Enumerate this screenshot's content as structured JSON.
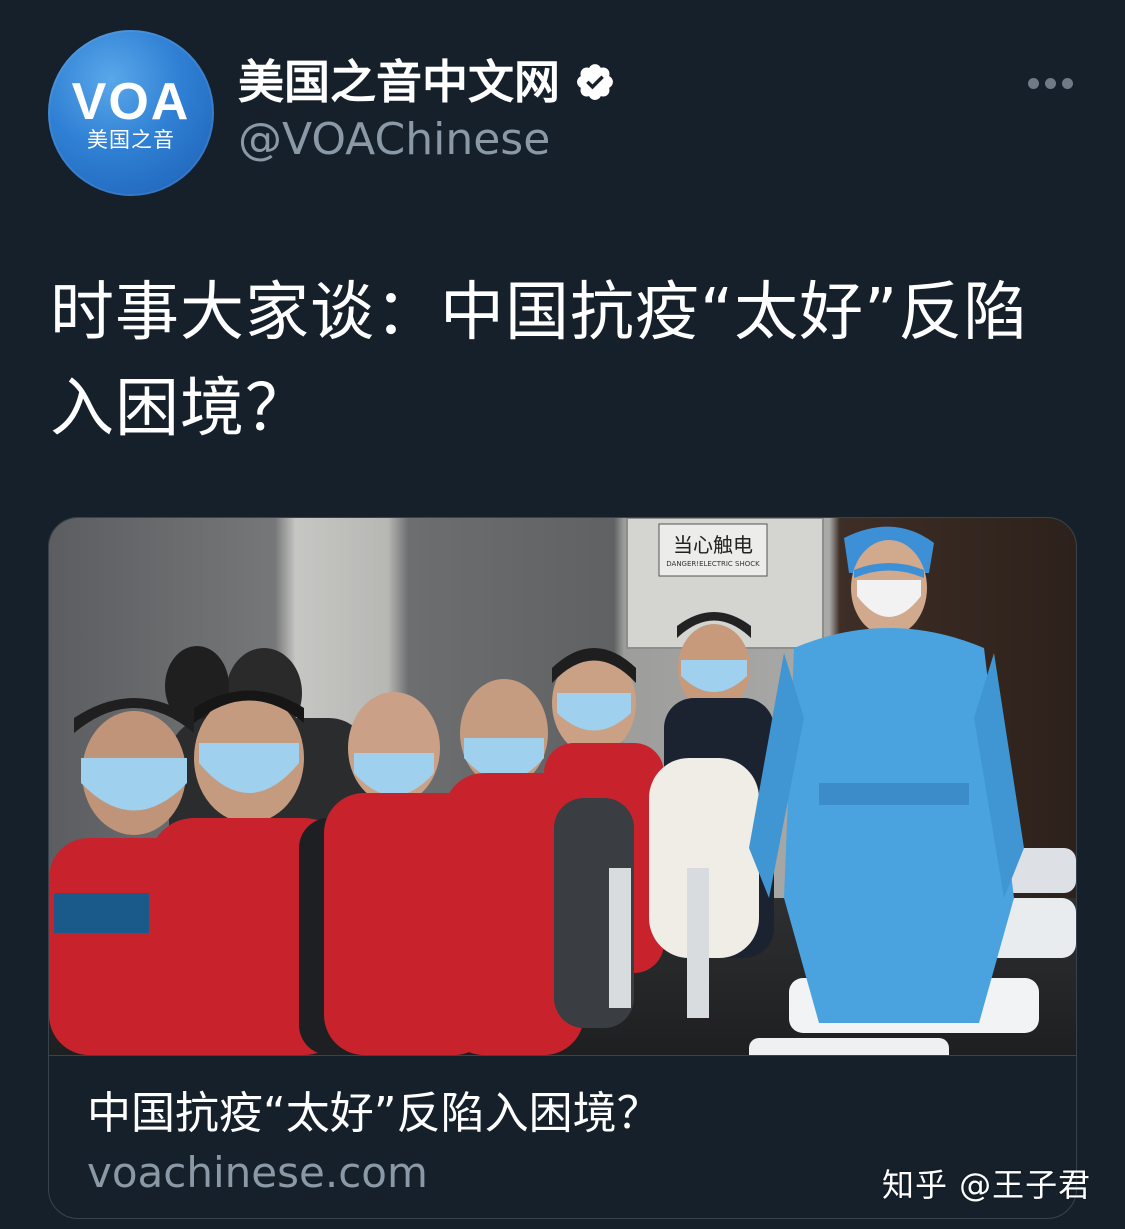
{
  "account": {
    "display_name": "美国之音中文网",
    "handle": "@VOAChinese",
    "verified": true,
    "avatar": {
      "logo_text": "VOA",
      "subtitle": "美国之音"
    }
  },
  "actions": {
    "more_icon": "more-horizontal-icon"
  },
  "tweet": {
    "text": "时事大家谈：中国抗疫“太好”反陷入困境？"
  },
  "link_card": {
    "image_description_icon": "photo",
    "title": "中国抗疫“太好”反陷入困境？",
    "domain": "voachinese.com",
    "image_text": {
      "sign_title": "当心触电",
      "sign_subtitle": "DANGER!ELECTRIC SHOCK"
    }
  },
  "watermark": {
    "text": "知乎 @王子君"
  },
  "colors": {
    "background": "#15202b",
    "primary_text": "#ffffff",
    "secondary_text": "#8b98a5",
    "border": "#38444d",
    "avatar_blue": "#2f80d4",
    "vest_red": "#c8232c",
    "gown_blue": "#4aa3df"
  }
}
